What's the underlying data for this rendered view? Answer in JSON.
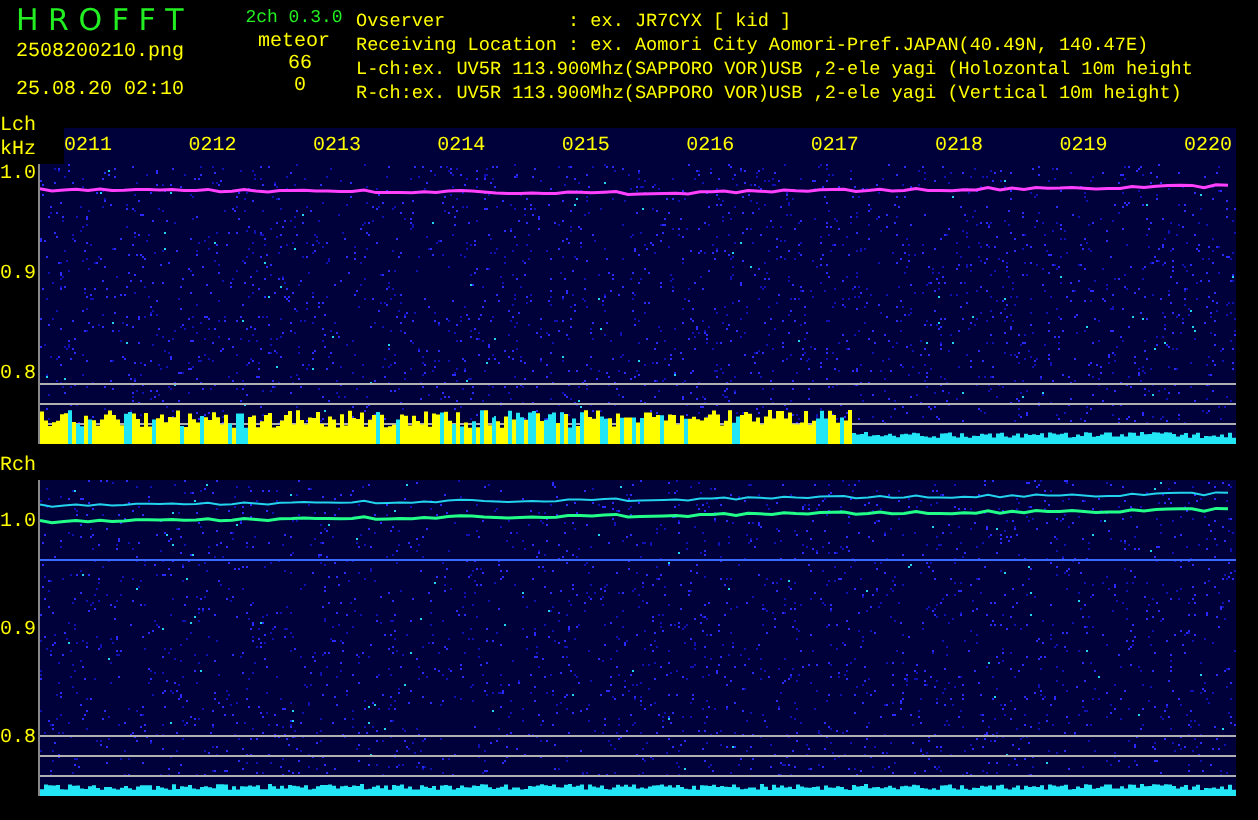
{
  "header": {
    "app_title": "H R O F F T",
    "version": "2ch 0.3.0",
    "filename": "2508200210.png",
    "mode": "meteor",
    "timestamp": "25.08.20 02:10",
    "counts": [
      "66",
      "0"
    ],
    "info_lines": [
      "Ovserver           : ex. JR7CYX [ kid ]",
      "Receiving Location : ex. Aomori City Aomori-Pref.JAPAN(40.49N, 140.47E)",
      "L-ch:ex. UV5R 113.900Mhz(SAPPORO VOR)USB ,2-ele yagi (Holozontal 10m height",
      "R-ch:ex. UV5R 113.900Mhz(SAPPORO VOR)USB ,2-ele yagi (Vertical 10m height)"
    ]
  },
  "channels": [
    {
      "label": "Lch",
      "kind": "detected",
      "unit": "kHz",
      "time_labels": [
        "0211",
        "0212",
        "0213",
        "0214",
        "0215",
        "0216",
        "0217",
        "0218",
        "0219",
        "0220"
      ],
      "freq_labels": [
        "1.0",
        "0.9",
        "0.8"
      ]
    },
    {
      "label": "Rch",
      "kind": "quiet",
      "freq_labels": [
        "1.0",
        "0.9",
        "0.8"
      ]
    }
  ]
}
